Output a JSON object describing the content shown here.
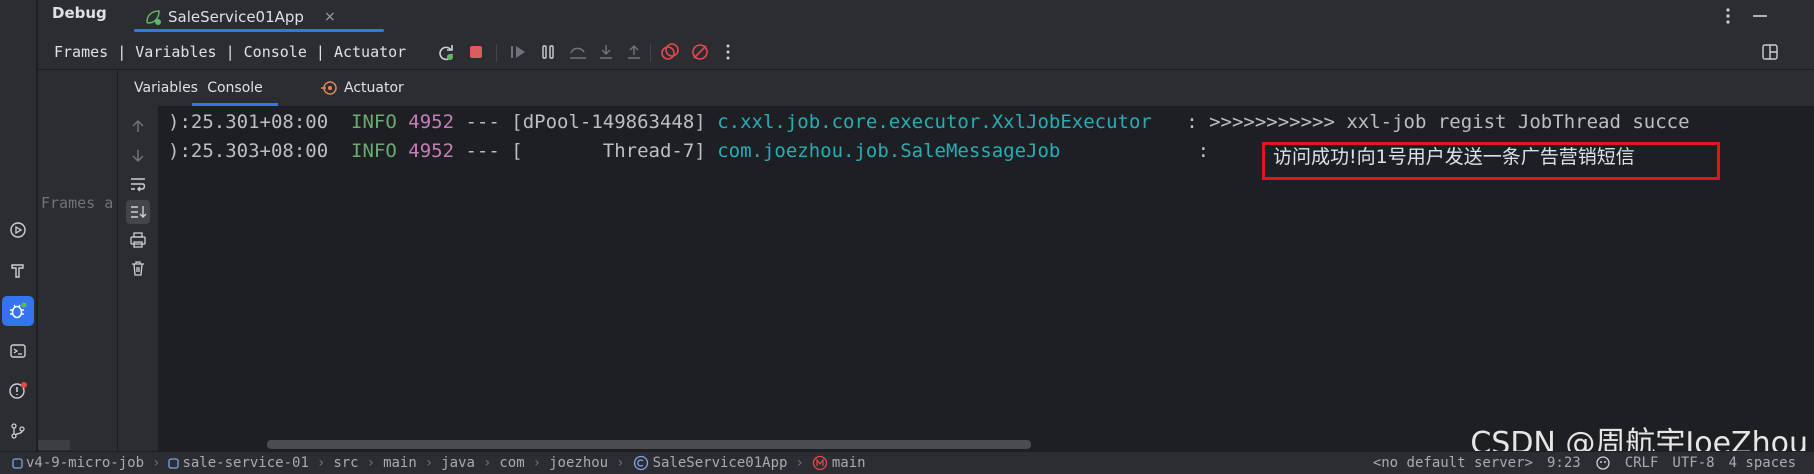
{
  "header": {
    "title": "Debug",
    "app_tab": "SaleService01App",
    "close_glyph": "×"
  },
  "toolbar": {
    "links": "Frames | Variables | Console | Actuator"
  },
  "frames_pane": {
    "label": "Frames a"
  },
  "inner_tabs": [
    {
      "label": "Variables"
    },
    {
      "label": "Console"
    },
    {
      "label": "Actuator"
    }
  ],
  "console": {
    "lines": [
      {
        "timestamp": "):25.301+08:00",
        "level": "INFO",
        "pid": "4952",
        "sep": "---",
        "thread": "[dPool-149863448]",
        "logger": "c.xxl.job.core.executor.XxlJobExecutor",
        "message": ": >>>>>>>>>>> xxl-job regist JobThread succe"
      },
      {
        "timestamp": "):25.303+08:00",
        "level": "INFO",
        "pid": "4952",
        "sep": "---",
        "thread": "[       Thread-7]",
        "logger": "com.joezhou.job.SaleMessageJob",
        "message_prefix": ":",
        "message": "访问成功!向1号用户发送一条广告营销短信"
      }
    ]
  },
  "status_bar": {
    "crumbs": [
      "v4-9-micro-job",
      "sale-service-01",
      "src",
      "main",
      "java",
      "com",
      "joezhou",
      "SaleService01App",
      "main"
    ],
    "server": "<no default server>",
    "position": "9:23",
    "line_ending": "CRLF",
    "encoding": "UTF-8",
    "indent": "4 spaces"
  },
  "watermark": "CSDN @周航宇JoeZhou",
  "colors": {
    "accent": "#3574f0",
    "highlight_border": "#e5141b",
    "info": "#6aab73",
    "pid": "#c77dbb",
    "logger": "#2aacb8"
  }
}
